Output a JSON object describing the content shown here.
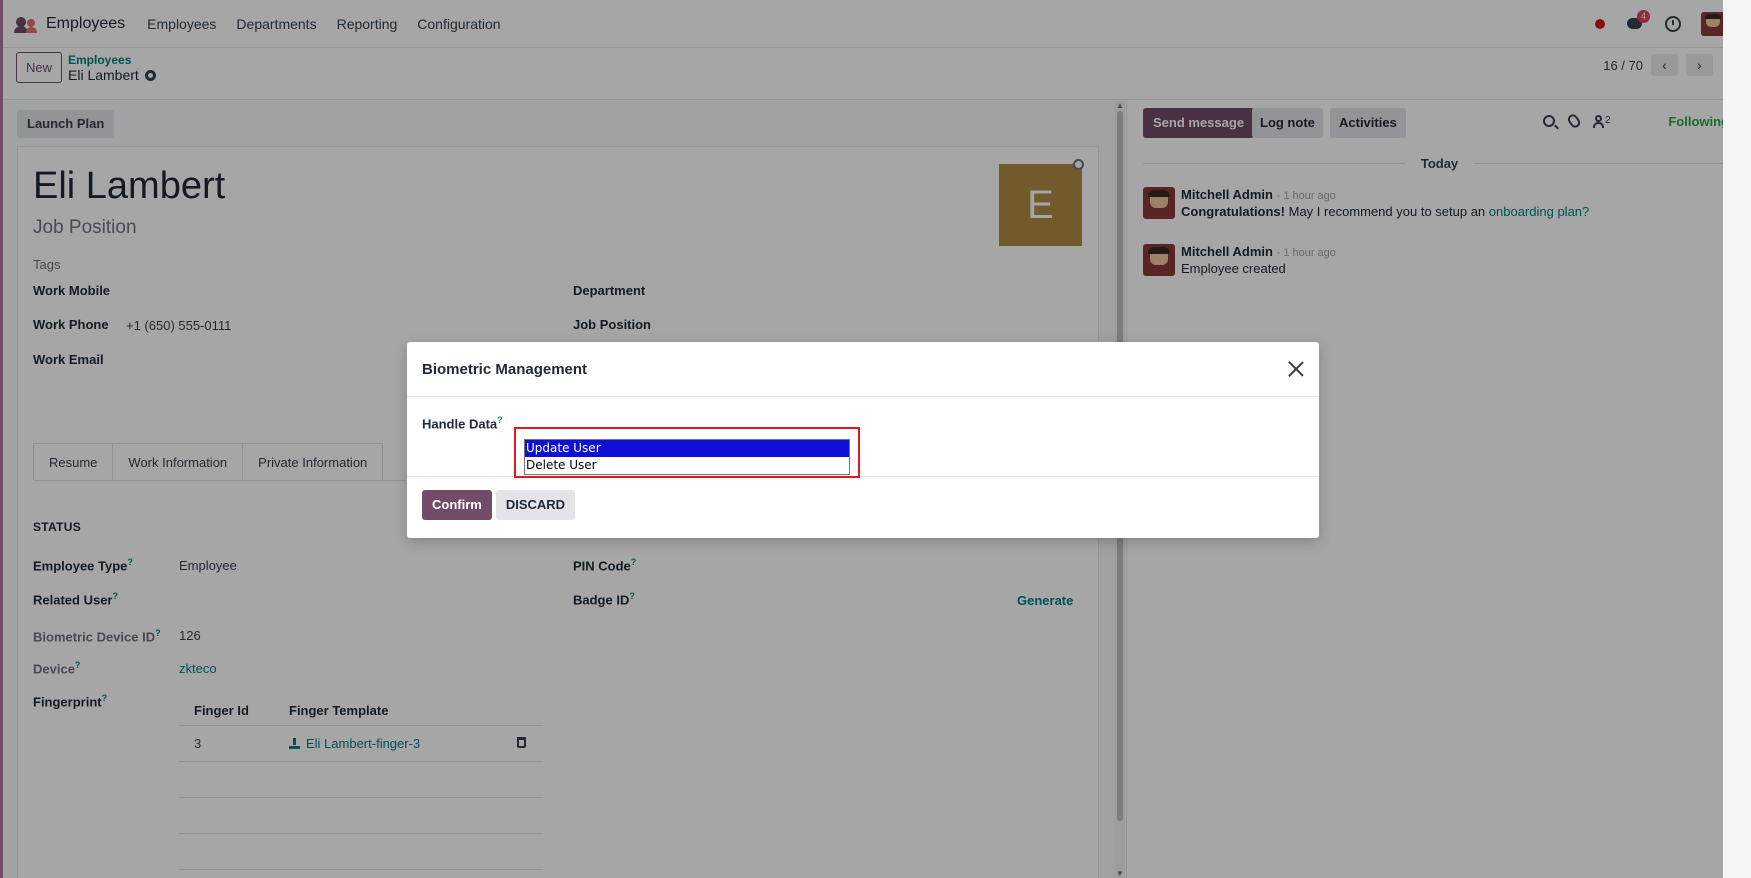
{
  "navbar": {
    "app_name": "Employees",
    "menu": [
      "Employees",
      "Departments",
      "Reporting",
      "Configuration"
    ],
    "message_count": "4"
  },
  "control": {
    "new_label": "New",
    "breadcrumb_parent": "Employees",
    "breadcrumb_current": "Eli Lambert",
    "pager": "16 / 70"
  },
  "form": {
    "launch_plan": "Launch Plan",
    "name": "Eli Lambert",
    "job_position_placeholder": "Job Position",
    "tags_placeholder": "Tags",
    "avatar_letter": "E",
    "labels": {
      "work_mobile": "Work Mobile",
      "work_phone": "Work Phone",
      "work_email": "Work Email",
      "department": "Department",
      "job_position": "Job Position",
      "status": "STATUS",
      "employee_type": "Employee Type",
      "related_user": "Related User",
      "biometric_device_id": "Biometric Device ID",
      "device": "Device",
      "fingerprint": "Fingerprint",
      "pin_code": "PIN Code",
      "badge_id": "Badge ID"
    },
    "values": {
      "work_phone": "+1 (650) 555-0111",
      "employee_type": "Employee",
      "biometric_device_id": "126",
      "device": "zkteco",
      "generate": "Generate"
    },
    "tabs": [
      "Resume",
      "Work Information",
      "Private Information"
    ],
    "fingerprint_table": {
      "headers": [
        "Finger Id",
        "Finger Template"
      ],
      "rows": [
        {
          "finger_id": "3",
          "template": "Eli Lambert-finger-3"
        }
      ]
    }
  },
  "chatter": {
    "send_message": "Send message",
    "log_note": "Log note",
    "activities": "Activities",
    "follower_count": "2",
    "following": "Following",
    "today": "Today",
    "messages": [
      {
        "author": "Mitchell Admin",
        "time": "- 1 hour ago",
        "bold": "Congratulations!",
        "text": " May I recommend you to setup an ",
        "link": "onboarding plan?"
      },
      {
        "author": "Mitchell Admin",
        "time": "- 1 hour ago",
        "text": "Employee created"
      }
    ]
  },
  "modal": {
    "title": "Biometric Management",
    "handle_data_label": "Handle Data",
    "options": [
      "Update User",
      "Delete User"
    ],
    "selected_option": "Update User",
    "confirm": "Confirm",
    "discard": "DISCARD"
  },
  "colors": {
    "brand": "#714b67",
    "link": "#017e84",
    "following": "#28a745",
    "highlight_border": "#e5171b",
    "selected_option_bg": "#1010d4"
  },
  "icons": [
    "employees-app-icon",
    "gear-icon",
    "chat-icon",
    "clock-icon",
    "search-icon",
    "paperclip-icon",
    "follower-icon",
    "close-icon",
    "download-icon",
    "trash-icon"
  ]
}
